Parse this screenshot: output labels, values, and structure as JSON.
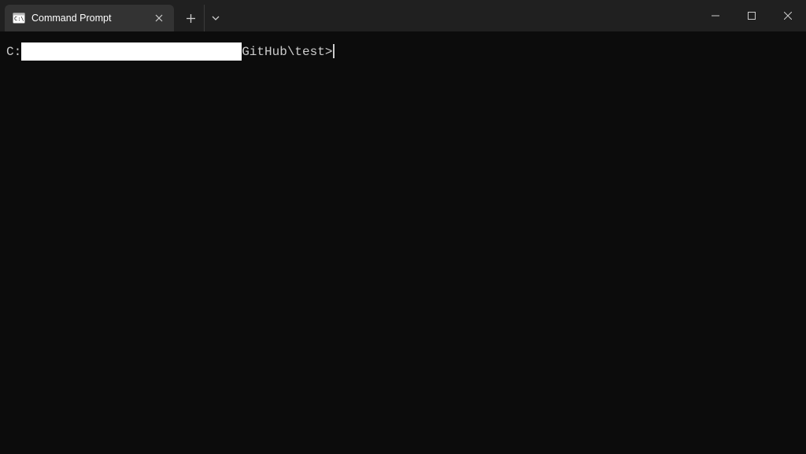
{
  "tab": {
    "title": "Command Prompt"
  },
  "prompt": {
    "drive": "C:",
    "path_suffix": "GitHub\\test>"
  }
}
